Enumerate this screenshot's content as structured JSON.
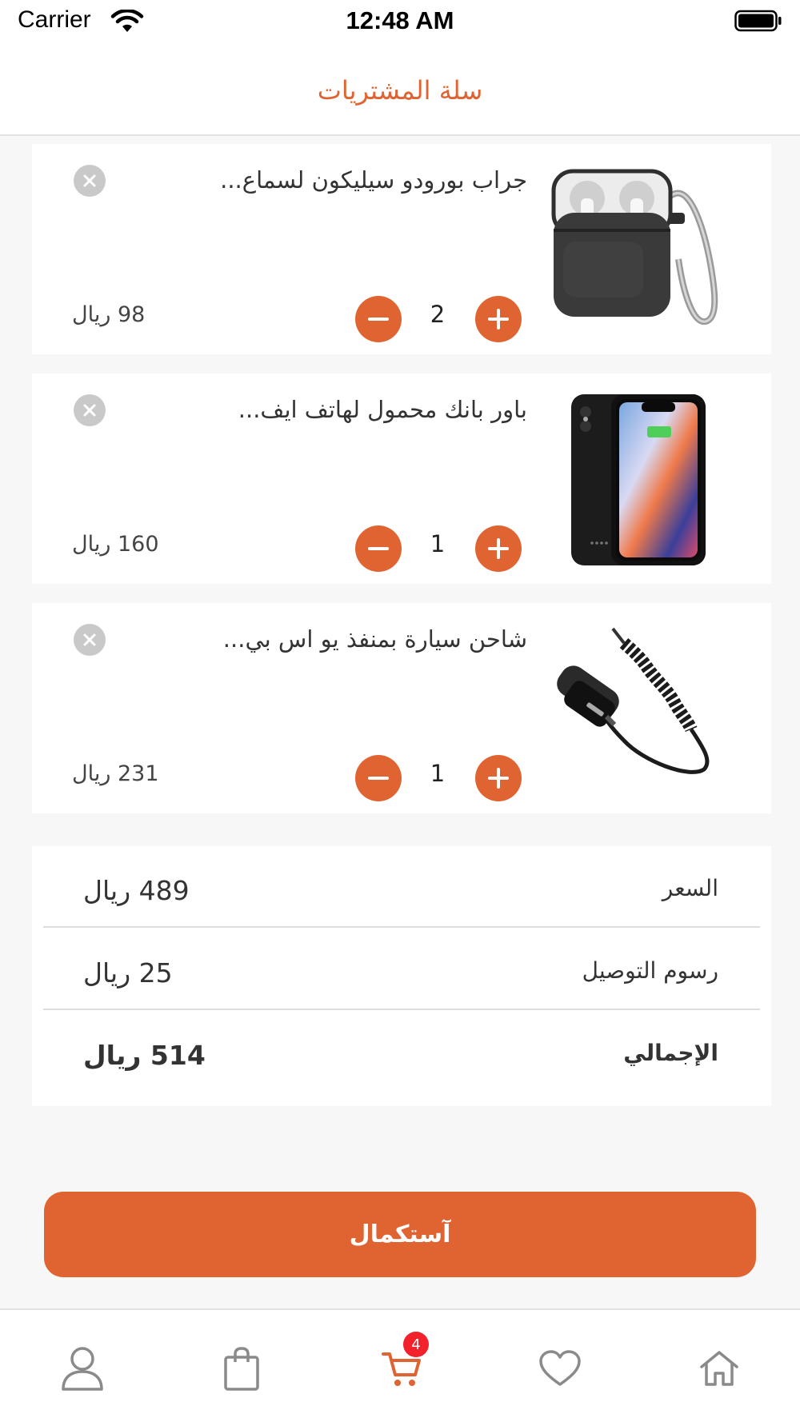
{
  "status_bar": {
    "carrier": "Carrier",
    "time": "12:48 AM"
  },
  "header": {
    "title": "سلة المشتريات"
  },
  "cart": {
    "items": [
      {
        "name": "جراب بورودو سيليكون لسماع...",
        "quantity": "2",
        "price": "98 ريال",
        "image": "airpods-case-image"
      },
      {
        "name": "باور بانك محمول لهاتف ايف...",
        "quantity": "1",
        "price": "160 ريال",
        "image": "phone-battery-case-image"
      },
      {
        "name": "شاحن سيارة بمنفذ يو اس بي...",
        "quantity": "1",
        "price": "231 ريال",
        "image": "car-charger-image"
      }
    ]
  },
  "summary": {
    "subtotal_label": "السعر",
    "subtotal_value": "489 ريال",
    "delivery_label": "رسوم التوصيل",
    "delivery_value": "25 ريال",
    "total_label": "الإجمالي",
    "total_value": "514 ريال"
  },
  "checkout": {
    "label": "آستكمال"
  },
  "tab_bar": {
    "items": [
      "profile-icon",
      "bag-icon",
      "cart-icon",
      "heart-icon",
      "home-icon"
    ],
    "cart_badge": "4",
    "active_color": "#e06432",
    "inactive_color": "#8a8a8a"
  },
  "colors": {
    "accent": "#e06432",
    "badge": "#f2212c"
  }
}
